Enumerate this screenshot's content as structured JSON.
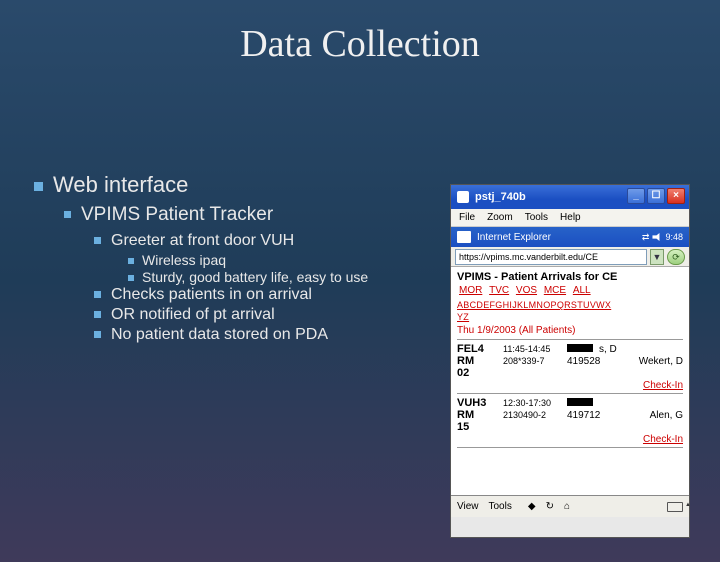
{
  "slide": {
    "title": "Data Collection",
    "bullets": {
      "lvl1": "Web interface",
      "lvl2": "VPIMS Patient Tracker",
      "lvl3a": "Greeter at front door VUH",
      "lvl4a": "Wireless ipaq",
      "lvl4b": "Sturdy, good battery life, easy to use",
      "lvl3b": "Checks patients in on arrival",
      "lvl3c": "OR notified of pt arrival",
      "lvl3d": "No patient data stored on PDA"
    }
  },
  "window": {
    "title": "pstj_740b",
    "min": "_",
    "max": "☐",
    "close": "×",
    "menu": {
      "file": "File",
      "zoom": "Zoom",
      "tools": "Tools",
      "help": "Help"
    }
  },
  "pda": {
    "app": "Internet Explorer",
    "time": "9:48",
    "url": "https://vpims.mc.vanderbilt.edu/CE",
    "dropdown": "▼",
    "go": "⟳",
    "heading": "VPIMS - Patient Arrivals for CE",
    "depts": {
      "mor": "MOR",
      "tvc": "TVC",
      "vos": "VOS",
      "mce": "MCE",
      "all": "ALL"
    },
    "alpha1": "ABCDEFGHIJKLMNOPQRSTUVWX",
    "alpha2": "YZ",
    "date": "Thu 1/9/2003 (All Patients)",
    "rows": [
      {
        "room": "FEL4",
        "rm": "RM",
        "rn": "02",
        "time": "11:45-14:45",
        "mrn": "208*339-7",
        "np": "s, D",
        "id2": "419528",
        "surg": "Wekert, D",
        "checkin": "Check-In"
      },
      {
        "room": "VUH3",
        "rm": "RM",
        "rn": "15",
        "time": "12:30-17:30",
        "mrn": "2130490-2",
        "np": "",
        "id2": "419712",
        "surg": "Alen, G",
        "checkin": "Check-In"
      }
    ],
    "foot": {
      "view": "View",
      "tools": "Tools"
    }
  }
}
